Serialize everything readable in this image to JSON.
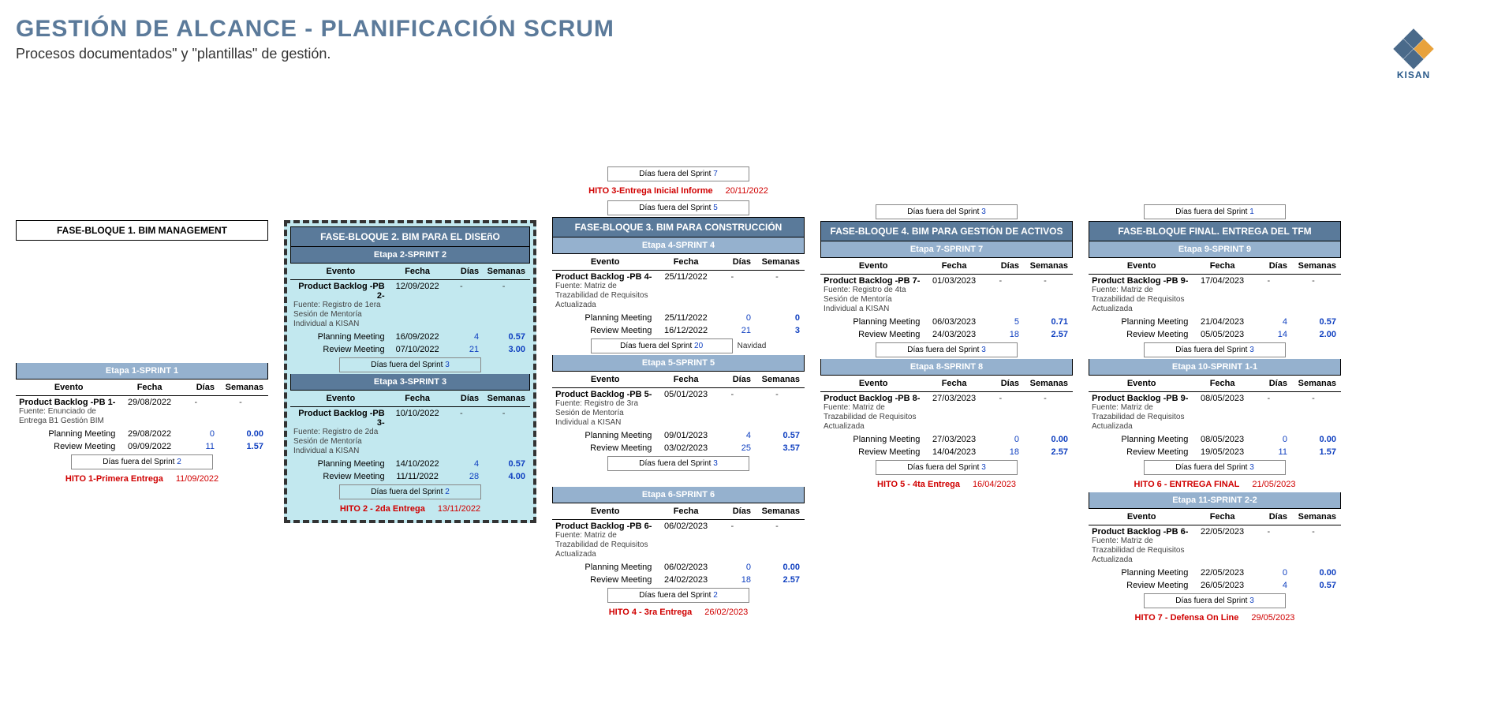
{
  "titles": {
    "main": "GESTIÓN DE ALCANCE - PLANIFICACIÓN SCRUM",
    "sub": "Procesos documentados\" y \"plantillas\" de gestión.",
    "logo": "KISAN"
  },
  "labels": {
    "evento": "Evento",
    "fecha": "Fecha",
    "dias": "Días",
    "semanas": "Semanas",
    "planning": "Planning Meeting",
    "review": "Review Meeting",
    "out_prefix": "Días fuera del Sprint ",
    "dash": "-"
  },
  "phases": {
    "p1": "FASE-BLOQUE 1. BIM MANAGEMENT",
    "p2": "FASE-BLOQUE 2. BIM PARA EL DISEñO",
    "p3": "FASE-BLOQUE 3. BIM PARA CONSTRUCCIÓN",
    "p4": "FASE-BLOQUE 4. BIM PARA GESTIÓN DE ACTIVOS",
    "p5": "FASE-BLOQUE FINAL. ENTREGA DEL TFM"
  },
  "out": {
    "top7": "7",
    "top5": "5",
    "top3": "3",
    "top1": "1",
    "s1": "2",
    "s2": "3",
    "s3": "2",
    "s4": "20",
    "s4_note": "Navidad",
    "s5": "3",
    "s6": "2",
    "s7": "3",
    "s8": "3",
    "s9": "3",
    "s10": "3",
    "s11": "3"
  },
  "sprints": {
    "s1": {
      "title": "Etapa 1-SPRINT 1",
      "pb": "Product Backlog -PB 1-",
      "src": "Fuente: Enunciado de Entrega B1 Gestión BIM",
      "date": "29/08/2022",
      "pl_date": "29/08/2022",
      "pl_d": "0",
      "pl_w": "0.00",
      "rv_date": "09/09/2022",
      "rv_d": "11",
      "rv_w": "1.57"
    },
    "s2": {
      "title": "Etapa 2-SPRINT 2",
      "pb": "Product Backlog -PB 2-",
      "src": "Fuente: Registro de 1era Sesión de Mentoría Individual a KISAN",
      "date": "12/09/2022",
      "pl_date": "16/09/2022",
      "pl_d": "4",
      "pl_w": "0.57",
      "rv_date": "07/10/2022",
      "rv_d": "21",
      "rv_w": "3.00"
    },
    "s3": {
      "title": "Etapa 3-SPRINT 3",
      "pb": "Product Backlog -PB 3-",
      "src": "Fuente: Registro de 2da Sesión de Mentoría Individual a KISAN",
      "date": "10/10/2022",
      "pl_date": "14/10/2022",
      "pl_d": "4",
      "pl_w": "0.57",
      "rv_date": "11/11/2022",
      "rv_d": "28",
      "rv_w": "4.00"
    },
    "s4": {
      "title": "Etapa 4-SPRINT 4",
      "pb": "Product Backlog -PB 4-",
      "src": "Fuente: Matriz de Trazabilidad de Requisitos Actualizada",
      "date": "25/11/2022",
      "pl_date": "25/11/2022",
      "pl_d": "0",
      "pl_w": "0",
      "rv_date": "16/12/2022",
      "rv_d": "21",
      "rv_w": "3"
    },
    "s5": {
      "title": "Etapa 5-SPRINT 5",
      "pb": "Product Backlog -PB 5-",
      "src": "Fuente: Registro de 3ra Sesión de Mentoría Individual a KISAN",
      "date": "05/01/2023",
      "pl_date": "09/01/2023",
      "pl_d": "4",
      "pl_w": "0.57",
      "rv_date": "03/02/2023",
      "rv_d": "25",
      "rv_w": "3.57"
    },
    "s6": {
      "title": "Etapa 6-SPRINT 6",
      "pb": "Product Backlog -PB 6-",
      "src": "Fuente: Matriz de Trazabilidad de Requisitos Actualizada",
      "date": "06/02/2023",
      "pl_date": "06/02/2023",
      "pl_d": "0",
      "pl_w": "0.00",
      "rv_date": "24/02/2023",
      "rv_d": "18",
      "rv_w": "2.57"
    },
    "s7": {
      "title": "Etapa 7-SPRINT 7",
      "pb": "Product Backlog -PB 7-",
      "src": "Fuente: Registro de 4ta Sesión de Mentoría Individual a KISAN",
      "date": "01/03/2023",
      "pl_date": "06/03/2023",
      "pl_d": "5",
      "pl_w": "0.71",
      "rv_date": "24/03/2023",
      "rv_d": "18",
      "rv_w": "2.57"
    },
    "s8": {
      "title": "Etapa 8-SPRINT 8",
      "pb": "Product Backlog -PB 8-",
      "src": "Fuente: Matriz de Trazabilidad de Requisitos Actualizada",
      "date": "27/03/2023",
      "pl_date": "27/03/2023",
      "pl_d": "0",
      "pl_w": "0.00",
      "rv_date": "14/04/2023",
      "rv_d": "18",
      "rv_w": "2.57"
    },
    "s9": {
      "title": "Etapa 9-SPRINT 9",
      "pb": "Product Backlog -PB 9-",
      "src": "Fuente: Matriz de Trazabilidad de Requisitos Actualizada",
      "date": "17/04/2023",
      "pl_date": "21/04/2023",
      "pl_d": "4",
      "pl_w": "0.57",
      "rv_date": "05/05/2023",
      "rv_d": "14",
      "rv_w": "2.00"
    },
    "s10": {
      "title": "Etapa 10-SPRINT 1-1",
      "pb": "Product Backlog -PB 9-",
      "src": "Fuente: Matriz de Trazabilidad de Requisitos Actualizada",
      "date": "08/05/2023",
      "pl_date": "08/05/2023",
      "pl_d": "0",
      "pl_w": "0.00",
      "rv_date": "19/05/2023",
      "rv_d": "11",
      "rv_w": "1.57"
    },
    "s11": {
      "title": "Etapa 11-SPRINT 2-2",
      "pb": "Product Backlog -PB 6-",
      "src": "Fuente: Matriz de Trazabilidad de Requisitos Actualizada",
      "date": "22/05/2023",
      "pl_date": "22/05/2023",
      "pl_d": "0",
      "pl_w": "0.00",
      "rv_date": "26/05/2023",
      "rv_d": "4",
      "rv_w": "0.57"
    }
  },
  "hitos": {
    "h1": {
      "label": "HITO 1-Primera Entrega",
      "date": "11/09/2022"
    },
    "h2": {
      "label": "HITO 2 - 2da Entrega",
      "date": "13/11/2022"
    },
    "h3": {
      "label": "HITO 3-Entrega Inicial Informe",
      "date": "20/11/2022"
    },
    "h4": {
      "label": "HITO 4 - 3ra Entrega",
      "date": "26/02/2023"
    },
    "h5": {
      "label": "HITO 5 - 4ta Entrega",
      "date": "16/04/2023"
    },
    "h6": {
      "label": "HITO 6 - ENTREGA FINAL",
      "date": "21/05/2023"
    },
    "h7": {
      "label": "HITO 7 - Defensa On Line",
      "date": "29/05/2023"
    }
  }
}
